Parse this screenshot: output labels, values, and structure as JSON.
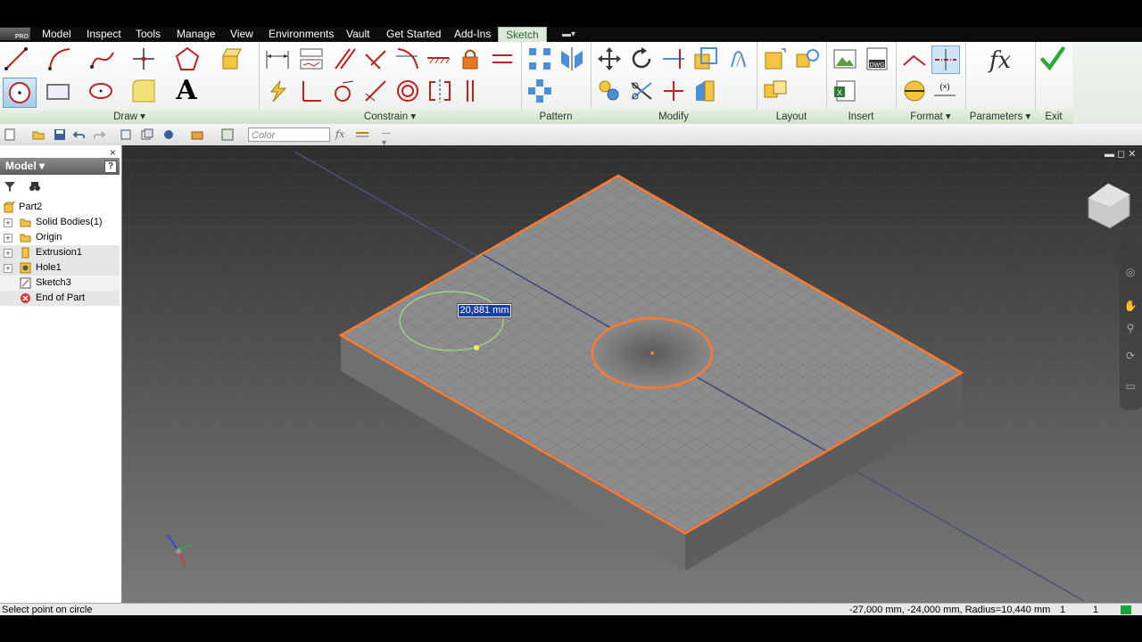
{
  "menu": {
    "logo_text": "PRO",
    "items": [
      "Model",
      "Inspect",
      "Tools",
      "Manage",
      "View",
      "Environments",
      "Vault",
      "Get Started",
      "Add-Ins",
      "Sketch"
    ],
    "active": "Sketch"
  },
  "ribbon": {
    "groups": {
      "draw": "Draw ▾",
      "constrain": "Constrain ▾",
      "pattern": "Pattern",
      "modify": "Modify",
      "layout": "Layout",
      "insert": "Insert",
      "format": "Format ▾",
      "parameters": "Parameters ▾",
      "exit": "Exit"
    },
    "tools": {
      "line": "line-icon",
      "arc": "arc-icon",
      "spline": "spline-icon",
      "point": "point-icon",
      "polygon": "polygon-icon",
      "project": "project-geometry-icon",
      "circle": "circle-icon",
      "rectangle": "rectangle-icon",
      "ellipse": "ellipse-icon",
      "fillet": "fillet-icon",
      "text": "text-icon",
      "fx_label": "fx",
      "finish_check": "finish-sketch-check-icon"
    }
  },
  "qat": {
    "color_placeholder": "Color",
    "fx_label": "fx"
  },
  "browser": {
    "title": "Model ▾",
    "help": "?",
    "close": "×",
    "tree": [
      {
        "label": "Part2",
        "icon": "part-icon",
        "expander": ""
      },
      {
        "label": "Solid Bodies(1)",
        "icon": "folder-icon",
        "expander": "+"
      },
      {
        "label": "Origin",
        "icon": "folder-icon",
        "expander": "+"
      },
      {
        "label": "Extrusion1",
        "icon": "extrusion-icon",
        "expander": "+"
      },
      {
        "label": "Hole1",
        "icon": "hole-icon",
        "expander": "+"
      },
      {
        "label": "Sketch3",
        "icon": "sketch-icon",
        "expander": ""
      },
      {
        "label": "End of Part",
        "icon": "end-of-part-icon",
        "expander": ""
      }
    ]
  },
  "viewport": {
    "dimension_value": "20,881 mm",
    "colors": {
      "edge": "#ff7a2e",
      "face": "#8a8a8a",
      "grid": "#6f6f6f",
      "preview_circle": "#9fe07f"
    }
  },
  "status": {
    "prompt": "Select point on circle",
    "coords": "-27,000 mm, -24,000 mm, Radius=10,440 mm",
    "count1": "1",
    "count2": "1"
  }
}
